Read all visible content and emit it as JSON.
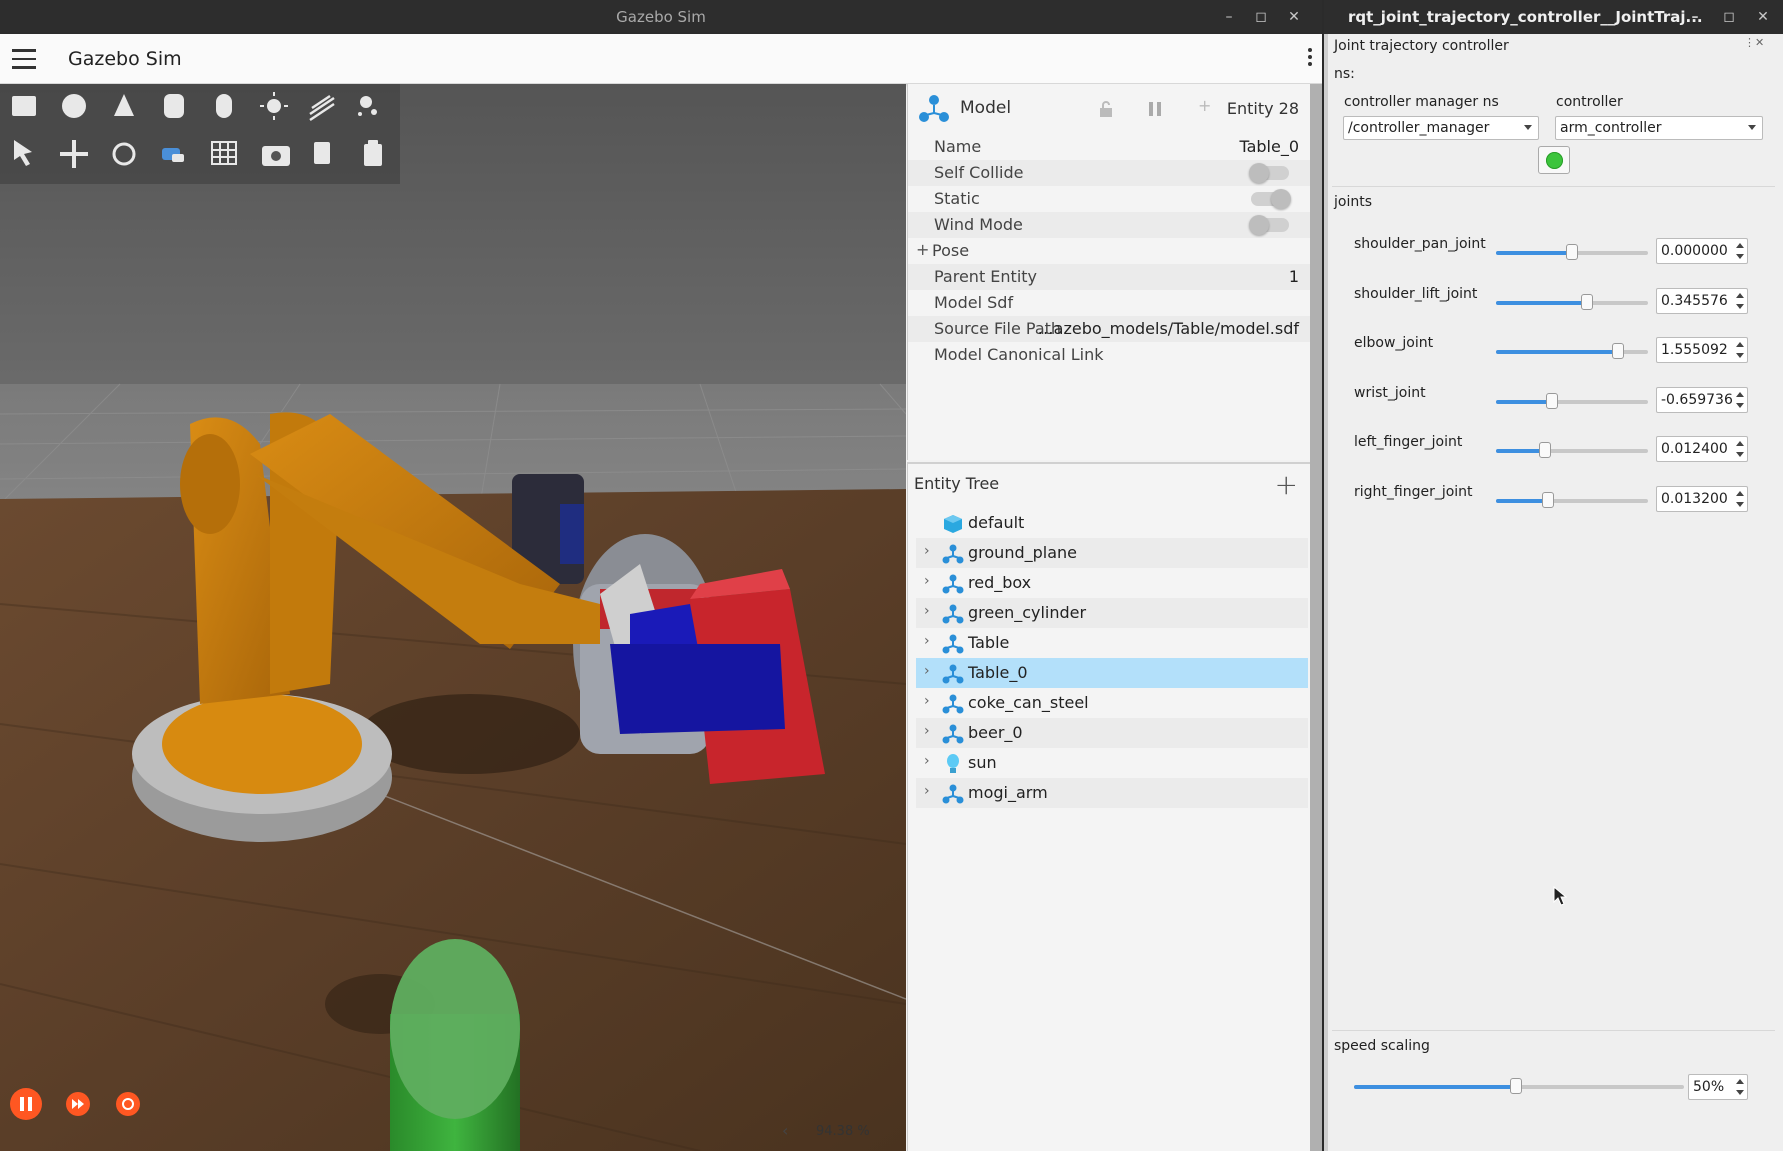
{
  "gazebo": {
    "window_title": "Gazebo Sim",
    "app_title": "Gazebo Sim",
    "zoom": "94.38 %",
    "inspector": {
      "title": "Model",
      "entity": "Entity 28",
      "rows": [
        {
          "key": "Name",
          "value": "Table_0"
        },
        {
          "key": "Self Collide",
          "toggle": false
        },
        {
          "key": "Static",
          "toggle": true
        },
        {
          "key": "Wind Mode",
          "toggle": false
        },
        {
          "key": "Pose",
          "value": ""
        },
        {
          "key": "Parent Entity",
          "value": "1"
        },
        {
          "key": "Model Sdf",
          "value": ""
        },
        {
          "key": "Source File Path",
          "value": "…azebo_models/Table/model.sdf"
        },
        {
          "key": "Model Canonical Link",
          "value": ""
        }
      ],
      "pose_prefix": "+"
    },
    "tree": {
      "title": "Entity Tree",
      "items": [
        {
          "label": "default",
          "icon": "cube-icon",
          "expandable": false
        },
        {
          "label": "ground_plane",
          "icon": "model-icon",
          "expandable": true
        },
        {
          "label": "red_box",
          "icon": "model-icon",
          "expandable": true
        },
        {
          "label": "green_cylinder",
          "icon": "model-icon",
          "expandable": true
        },
        {
          "label": "Table",
          "icon": "model-icon",
          "expandable": true
        },
        {
          "label": "Table_0",
          "icon": "model-icon",
          "expandable": true,
          "selected": true
        },
        {
          "label": "coke_can_steel",
          "icon": "model-icon",
          "expandable": true
        },
        {
          "label": "beer_0",
          "icon": "model-icon",
          "expandable": true
        },
        {
          "label": "sun",
          "icon": "light-bulb-icon",
          "expandable": true
        },
        {
          "label": "mogi_arm",
          "icon": "model-icon",
          "expandable": true
        }
      ]
    },
    "accent": "#ff5722",
    "selection_color": "#b3e0fa"
  },
  "rqt": {
    "window_title": "rqt_joint_trajectory_controller__JointTraj...",
    "plugin_title": "Joint trajectory controller",
    "ns_label": "ns:",
    "cm_ns_label": "controller manager ns",
    "cm_ns_value": "/controller_manager",
    "controller_label": "controller",
    "controller_value": "arm_controller",
    "joints_label": "joints",
    "joints": [
      {
        "name": "shoulder_pan_joint",
        "value": "0.000000",
        "fraction": 0.5
      },
      {
        "name": "shoulder_lift_joint",
        "value": "0.345576",
        "fraction": 0.6
      },
      {
        "name": "elbow_joint",
        "value": "1.555092",
        "fraction": 0.8
      },
      {
        "name": "wrist_joint",
        "value": "-0.659736",
        "fraction": 0.37
      },
      {
        "name": "left_finger_joint",
        "value": "0.012400",
        "fraction": 0.32
      },
      {
        "name": "right_finger_joint",
        "value": "0.013200",
        "fraction": 0.34
      }
    ],
    "speed_label": "speed scaling",
    "speed_value": "50%",
    "speed_fraction": 0.49,
    "slider_color": "#3d8fe0"
  }
}
